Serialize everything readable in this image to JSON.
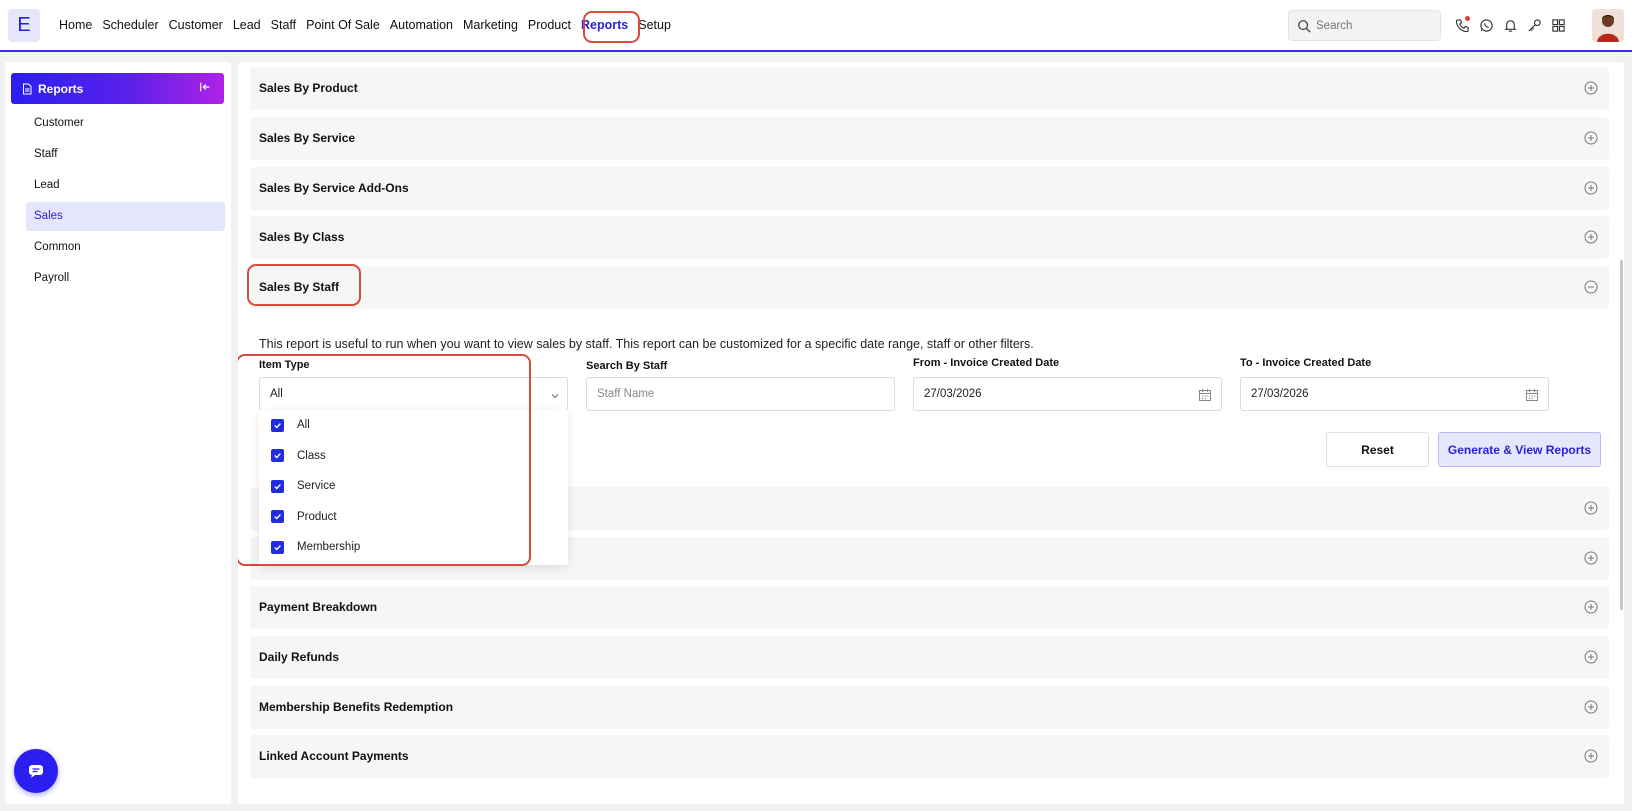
{
  "app": {
    "logo_letter": "E"
  },
  "nav": {
    "items": [
      "Home",
      "Scheduler",
      "Customer",
      "Lead",
      "Staff",
      "Point Of Sale",
      "Automation",
      "Marketing",
      "Product",
      "Reports",
      "Setup"
    ],
    "active": "Reports"
  },
  "search": {
    "placeholder": "Search"
  },
  "top_icons": [
    "phone-icon",
    "whatsapp-icon",
    "bell-icon",
    "key-icon",
    "apps-grid-icon"
  ],
  "sidebar": {
    "title": "Reports",
    "items": [
      {
        "label": "Customer"
      },
      {
        "label": "Staff"
      },
      {
        "label": "Lead"
      },
      {
        "label": "Sales"
      },
      {
        "label": "Common"
      },
      {
        "label": "Payroll"
      }
    ],
    "active": "Sales"
  },
  "reports": {
    "sales_by_product": "Sales By Product",
    "sales_by_service": "Sales By Service",
    "sales_by_service_addons": "Sales By Service Add-Ons",
    "sales_by_class": "Sales By Class",
    "sales_by_staff": "Sales By Staff",
    "payment_breakdown": "Payment Breakdown",
    "daily_refunds": "Daily Refunds",
    "membership_benefits": "Membership Benefits Redemption",
    "linked_account_payments": "Linked Account Payments"
  },
  "staff_report": {
    "description": "This report is useful to run when you want to view sales by staff. This report can be customized for a specific date range, staff or other filters.",
    "item_type_label": "Item Type",
    "item_type_value": "All",
    "search_staff_label": "Search By Staff",
    "search_staff_placeholder": "Staff Name",
    "from_label": "From - Invoice Created Date",
    "from_value": "27/03/2026",
    "to_label": "To - Invoice Created Date",
    "to_value": "27/03/2026",
    "reset_label": "Reset",
    "generate_label": "Generate & View Reports"
  },
  "item_type_options": [
    {
      "label": "All",
      "checked": true
    },
    {
      "label": "Class",
      "checked": true
    },
    {
      "label": "Service",
      "checked": true
    },
    {
      "label": "Product",
      "checked": true
    },
    {
      "label": "Membership",
      "checked": true
    }
  ],
  "colors": {
    "accent": "#2a22d6",
    "highlight": "#d94a3a"
  }
}
